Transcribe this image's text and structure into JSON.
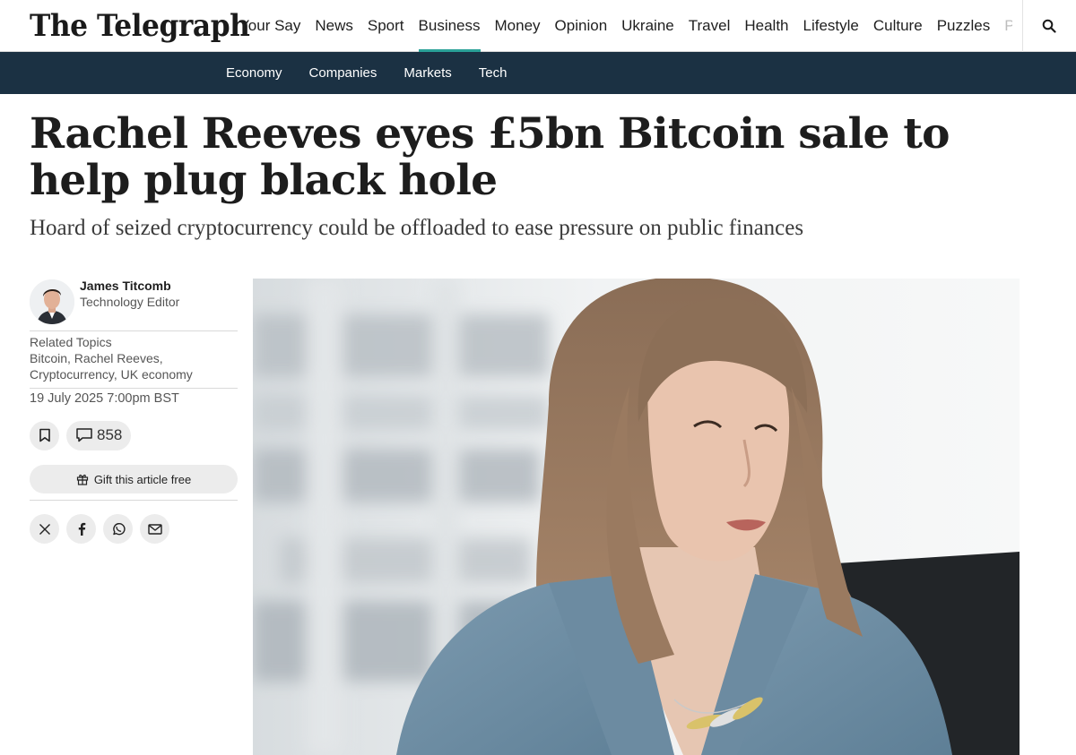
{
  "brand": {
    "logo": "The Telegraph"
  },
  "nav": {
    "items": [
      "Your Say",
      "News",
      "Sport",
      "Business",
      "Money",
      "Opinion",
      "Ukraine",
      "Travel",
      "Health",
      "Lifestyle",
      "Culture",
      "Puzzles",
      "P"
    ],
    "active": "Business"
  },
  "subnav": {
    "items": [
      "Economy",
      "Companies",
      "Markets",
      "Tech"
    ]
  },
  "article": {
    "headline": "Rachel Reeves eyes £5bn Bitcoin sale to help plug black hole",
    "standfirst": "Hoard of seized cryptocurrency could be offloaded to ease pressure on public finances",
    "author": {
      "name": "James Titcomb",
      "role": "Technology Editor"
    },
    "related_topics_title": "Related Topics",
    "related_topics": "Bitcoin, Rachel Reeves, Cryptocurrency, UK economy",
    "date": "19 July 2025 7:00pm BST",
    "comment_count": "858",
    "gift_label": "Gift this article free"
  },
  "colors": {
    "subnav_bg": "#1b3143",
    "active_underline": "#2aa198"
  },
  "icons": [
    "search-icon",
    "bookmark-icon",
    "comment-icon",
    "gift-icon",
    "x-icon",
    "facebook-icon",
    "whatsapp-icon",
    "email-icon"
  ]
}
